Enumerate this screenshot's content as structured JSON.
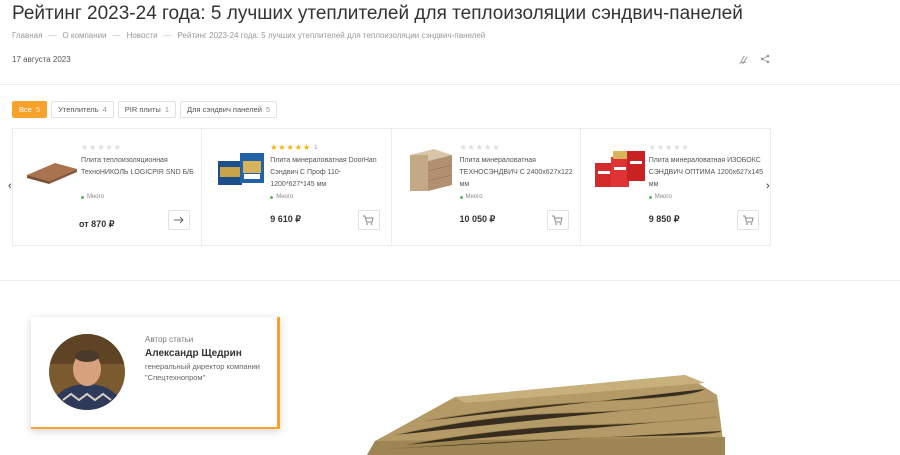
{
  "article": {
    "title": "Рейтинг 2023-24 года: 5 лучших утеплителей для теплоизоляции сэндвич-панелей",
    "date": "17 августа 2023"
  },
  "breadcrumb": [
    "Главная",
    "О компании",
    "Новости",
    "Рейтинг 2023-24 года: 5 лучших утеплителей для теплоизоляции сэндвич-панелей"
  ],
  "actions": {
    "icons": [
      "print-icon",
      "share-icon"
    ]
  },
  "filters": [
    {
      "label": "Все",
      "count": "5",
      "active": true
    },
    {
      "label": "Утеплитель",
      "count": "4",
      "active": false
    },
    {
      "label": "PIR плиты",
      "count": "1",
      "active": false
    },
    {
      "label": "Для сэндвич панелей",
      "count": "5",
      "active": false
    }
  ],
  "products": [
    {
      "name": "Плита теплоизоляционная ТехноНИКОЛЬ LOGICPIR SND Б/Б",
      "rating": 0,
      "rating_count": "",
      "stock": "Много",
      "price": "от 870 ₽",
      "button": "arrow-right-icon"
    },
    {
      "name": "Плита минераловатная DoorHan Сэндвич С Проф 110-1200*627*145 мм",
      "rating": 5,
      "rating_count": "1",
      "stock": "Много",
      "price": "9 610 ₽",
      "button": "cart-icon"
    },
    {
      "name": "Плита минераловатная ТЕХНОСЭНДВИЧ С 2400х627х122 мм",
      "rating": 0,
      "rating_count": "",
      "stock": "Много",
      "price": "10 050 ₽",
      "button": "cart-icon"
    },
    {
      "name": "Плита минераловатная ИЗОБОКС СЭНДВИЧ ОПТИМА 1200х627х145 мм",
      "rating": 0,
      "rating_count": "",
      "stock": "Много",
      "price": "9 850 ₽",
      "button": "cart-icon"
    }
  ],
  "author": {
    "caption": "Автор статьи",
    "name": "Александр Щедрин",
    "role": "генеральный директор компании \"Спецтехнопром\""
  },
  "colors": {
    "accent": "#f7a22b",
    "stock": "#5bb85d",
    "star": "#f4b400"
  }
}
